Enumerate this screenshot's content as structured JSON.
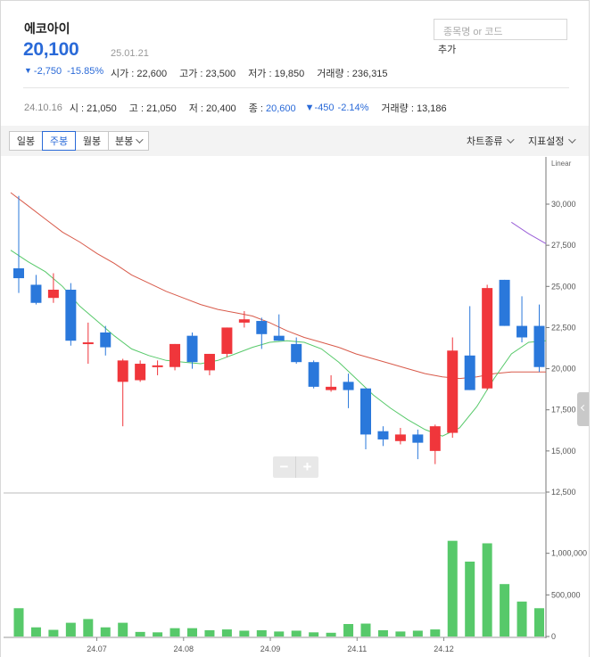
{
  "stock": {
    "name": "에코아이",
    "price": "20,100",
    "date": "25.01.21",
    "change_arrow": "▼",
    "change": "-2,750",
    "change_pct": "-15.85%",
    "open_label": "시가",
    "open": "22,600",
    "high_label": "고가",
    "high": "23,500",
    "low_label": "저가",
    "low": "19,850",
    "volume_label": "거래량",
    "volume": "236,315"
  },
  "search": {
    "placeholder": "종목명 or 코드",
    "add_label": "추가"
  },
  "daily": {
    "date": "24.10.16",
    "open_label": "시",
    "open": "21,050",
    "high_label": "고",
    "high": "21,050",
    "low_label": "저",
    "low": "20,400",
    "close_label": "종",
    "close": "20,600",
    "change": "▼-450",
    "change_pct": "-2.14%",
    "volume_label": "거래량",
    "volume": "13,186"
  },
  "toolbar": {
    "tabs": [
      "일봉",
      "주봉",
      "월봉",
      "분봉"
    ],
    "active_tab": "주봉",
    "chart_type_label": "차트종류",
    "indicator_label": "지표설정"
  },
  "zoom": {
    "minus": "−",
    "plus": "+"
  },
  "colors": {
    "up": "#f0363b",
    "down": "#2a78db",
    "ma_short": "#57c96a",
    "ma_long": "#d85a4a",
    "ma_extra": "#9a5fd8",
    "volume": "#57c96a"
  },
  "chart_data": {
    "type": "candlestick",
    "scale_label": "Linear",
    "price_ticks": [
      "30,000",
      "27,500",
      "25,000",
      "22,500",
      "20,000",
      "17,500",
      "15,000",
      "12,500"
    ],
    "volume_ticks": [
      "1,000,000",
      "500,000",
      "0"
    ],
    "price_range": [
      12500,
      31500
    ],
    "volume_range": [
      0,
      1500000
    ],
    "x_labels": [
      "24.07",
      "24.08",
      "24.09",
      "24.11",
      "24.12"
    ],
    "x_label_after_candle": [
      4,
      9,
      14,
      19,
      24
    ],
    "candles": [
      {
        "o": 26100,
        "h": 30500,
        "l": 24600,
        "c": 25500,
        "v": 340000
      },
      {
        "o": 25100,
        "h": 25700,
        "l": 23900,
        "c": 24000,
        "v": 110000
      },
      {
        "o": 24300,
        "h": 25800,
        "l": 24000,
        "c": 24800,
        "v": 80000
      },
      {
        "o": 24800,
        "h": 25200,
        "l": 21400,
        "c": 21700,
        "v": 165000
      },
      {
        "o": 21500,
        "h": 22800,
        "l": 20300,
        "c": 21600,
        "v": 210000
      },
      {
        "o": 22200,
        "h": 22600,
        "l": 20800,
        "c": 21300,
        "v": 110000
      },
      {
        "o": 19200,
        "h": 20600,
        "l": 16500,
        "c": 20500,
        "v": 165000
      },
      {
        "o": 19300,
        "h": 20500,
        "l": 19200,
        "c": 20300,
        "v": 55000
      },
      {
        "o": 20100,
        "h": 20500,
        "l": 19600,
        "c": 20200,
        "v": 50000
      },
      {
        "o": 20100,
        "h": 21500,
        "l": 19900,
        "c": 21500,
        "v": 100000
      },
      {
        "o": 22000,
        "h": 22200,
        "l": 20000,
        "c": 20400,
        "v": 100000
      },
      {
        "o": 19900,
        "h": 20900,
        "l": 19600,
        "c": 20900,
        "v": 75000
      },
      {
        "o": 20900,
        "h": 22500,
        "l": 20700,
        "c": 22500,
        "v": 85000
      },
      {
        "o": 22800,
        "h": 23500,
        "l": 22500,
        "c": 23000,
        "v": 70000
      },
      {
        "o": 22900,
        "h": 23100,
        "l": 21200,
        "c": 22100,
        "v": 75000
      },
      {
        "o": 22000,
        "h": 23300,
        "l": 21700,
        "c": 21700,
        "v": 60000
      },
      {
        "o": 21500,
        "h": 21900,
        "l": 20300,
        "c": 20400,
        "v": 70000
      },
      {
        "o": 20400,
        "h": 20500,
        "l": 18800,
        "c": 18900,
        "v": 50000
      },
      {
        "o": 18700,
        "h": 19600,
        "l": 18600,
        "c": 18900,
        "v": 45000
      },
      {
        "o": 19200,
        "h": 19700,
        "l": 17600,
        "c": 18700,
        "v": 150000
      },
      {
        "o": 18800,
        "h": 18800,
        "l": 15100,
        "c": 16000,
        "v": 155000
      },
      {
        "o": 16200,
        "h": 16500,
        "l": 15300,
        "c": 15700,
        "v": 75000
      },
      {
        "o": 15600,
        "h": 16400,
        "l": 15400,
        "c": 16000,
        "v": 60000
      },
      {
        "o": 16000,
        "h": 16300,
        "l": 14500,
        "c": 15500,
        "v": 70000
      },
      {
        "o": 15000,
        "h": 16600,
        "l": 14200,
        "c": 16500,
        "v": 85000
      },
      {
        "o": 16100,
        "h": 21900,
        "l": 15800,
        "c": 21100,
        "v": 1150000
      },
      {
        "o": 20800,
        "h": 23800,
        "l": 18700,
        "c": 18700,
        "v": 900000
      },
      {
        "o": 18800,
        "h": 25100,
        "l": 18700,
        "c": 24900,
        "v": 1120000
      },
      {
        "o": 25400,
        "h": 25400,
        "l": 22600,
        "c": 22600,
        "v": 630000
      },
      {
        "o": 22600,
        "h": 24400,
        "l": 21600,
        "c": 21900,
        "v": 420000
      },
      {
        "o": 22600,
        "h": 23900,
        "l": 19800,
        "c": 20100,
        "v": 340000
      }
    ],
    "ma_short": [
      27200,
      26500,
      25900,
      25000,
      23800,
      22900,
      22000,
      21200,
      20800,
      20500,
      20400,
      20300,
      20500,
      20900,
      21300,
      21600,
      21700,
      21600,
      21200,
      20400,
      19400,
      18400,
      17600,
      16900,
      16300,
      15900,
      16400,
      17700,
      19400,
      20900,
      21600,
      21700
    ],
    "ma_long": [
      30700,
      29900,
      29100,
      28300,
      27700,
      27000,
      26400,
      25700,
      25200,
      24700,
      24300,
      23900,
      23600,
      23400,
      23200,
      22800,
      22300,
      21900,
      21600,
      21300,
      20900,
      20600,
      20300,
      20000,
      19700,
      19500,
      19400,
      19500,
      19700,
      19800,
      19800,
      19800
    ],
    "ma_extra": [
      null,
      null,
      null,
      null,
      null,
      null,
      null,
      null,
      null,
      null,
      null,
      null,
      null,
      null,
      null,
      null,
      null,
      null,
      null,
      null,
      null,
      null,
      null,
      null,
      null,
      null,
      null,
      null,
      null,
      28900,
      28200,
      27600
    ]
  }
}
